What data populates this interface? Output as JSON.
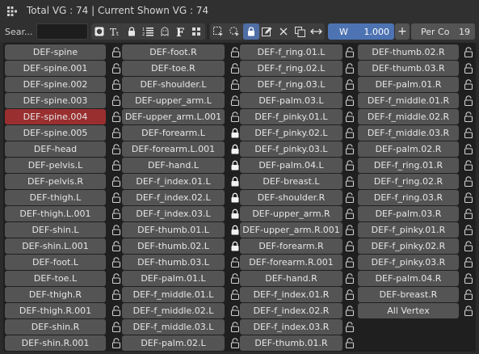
{
  "header": {
    "title": "Total VG : 74 | Current Shown VG : 74",
    "icon": "vertex-groups-icon"
  },
  "toolbar": {
    "search_label": "Sear...",
    "search_value": "",
    "icons": [
      "filter-circle-icon",
      "text-size-icon",
      "lock-icon",
      "numbered-list-icon",
      "ghost-icon",
      "font-f-icon",
      "grid-dots-icon",
      "select-box-icon",
      "select-circle-icon",
      "lock-toggle-icon",
      "edit-icon",
      "close-icon",
      "copy-icon",
      "swap-arrows-icon"
    ],
    "weight_label": "W",
    "weight_value": "1.000",
    "plus_label": "+",
    "perco_label": "Per Co",
    "perco_value": "19"
  },
  "columns": [
    [
      {
        "name": "DEF-spine",
        "locked": false
      },
      {
        "name": "DEF-spine.001",
        "locked": false
      },
      {
        "name": "DEF-spine.002",
        "locked": false
      },
      {
        "name": "DEF-spine.003",
        "locked": false
      },
      {
        "name": "DEF-spine.004",
        "locked": false,
        "selected": true
      },
      {
        "name": "DEF-spine.005",
        "locked": false
      },
      {
        "name": "DEF-head",
        "locked": false
      },
      {
        "name": "DEF-pelvis.L",
        "locked": false
      },
      {
        "name": "DEF-pelvis.R",
        "locked": false
      },
      {
        "name": "DEF-thigh.L",
        "locked": false
      },
      {
        "name": "DEF-thigh.L.001",
        "locked": false
      },
      {
        "name": "DEF-shin.L",
        "locked": false
      },
      {
        "name": "DEF-shin.L.001",
        "locked": false
      },
      {
        "name": "DEF-foot.L",
        "locked": false
      },
      {
        "name": "DEF-toe.L",
        "locked": false
      },
      {
        "name": "DEF-thigh.R",
        "locked": false
      },
      {
        "name": "DEF-thigh.R.001",
        "locked": false
      },
      {
        "name": "DEF-shin.R",
        "locked": false
      },
      {
        "name": "DEF-shin.R.001",
        "locked": false
      }
    ],
    [
      {
        "name": "DEF-foot.R",
        "locked": false
      },
      {
        "name": "DEF-toe.R",
        "locked": false
      },
      {
        "name": "DEF-shoulder.L",
        "locked": false
      },
      {
        "name": "DEF-upper_arm.L",
        "locked": false
      },
      {
        "name": "DEF-upper_arm.L.001",
        "locked": false
      },
      {
        "name": "DEF-forearm.L",
        "locked": true
      },
      {
        "name": "DEF-forearm.L.001",
        "locked": true
      },
      {
        "name": "DEF-hand.L",
        "locked": true
      },
      {
        "name": "DEF-f_index.01.L",
        "locked": true
      },
      {
        "name": "DEF-f_index.02.L",
        "locked": true
      },
      {
        "name": "DEF-f_index.03.L",
        "locked": true
      },
      {
        "name": "DEF-thumb.01.L",
        "locked": true
      },
      {
        "name": "DEF-thumb.02.L",
        "locked": true
      },
      {
        "name": "DEF-thumb.03.L",
        "locked": false
      },
      {
        "name": "DEF-palm.01.L",
        "locked": false
      },
      {
        "name": "DEF-f_middle.01.L",
        "locked": false
      },
      {
        "name": "DEF-f_middle.02.L",
        "locked": false
      },
      {
        "name": "DEF-f_middle.03.L",
        "locked": false
      },
      {
        "name": "DEF-palm.02.L",
        "locked": false
      }
    ],
    [
      {
        "name": "DEF-f_ring.01.L",
        "locked": false
      },
      {
        "name": "DEF-f_ring.02.L",
        "locked": false
      },
      {
        "name": "DEF-f_ring.03.L",
        "locked": false
      },
      {
        "name": "DEF-palm.03.L",
        "locked": false
      },
      {
        "name": "DEF-f_pinky.01.L",
        "locked": false
      },
      {
        "name": "DEF-f_pinky.02.L",
        "locked": false
      },
      {
        "name": "DEF-f_pinky.03.L",
        "locked": false
      },
      {
        "name": "DEF-palm.04.L",
        "locked": false
      },
      {
        "name": "DEF-breast.L",
        "locked": false
      },
      {
        "name": "DEF-shoulder.R",
        "locked": false
      },
      {
        "name": "DEF-upper_arm.R",
        "locked": false
      },
      {
        "name": "DEF-upper_arm.R.001",
        "locked": false
      },
      {
        "name": "DEF-forearm.R",
        "locked": false
      },
      {
        "name": "DEF-forearm.R.001",
        "locked": false
      },
      {
        "name": "DEF-hand.R",
        "locked": false
      },
      {
        "name": "DEF-f_index.01.R",
        "locked": false
      },
      {
        "name": "DEF-f_index.02.R",
        "locked": false
      },
      {
        "name": "DEF-f_index.03.R",
        "locked": false
      },
      {
        "name": "DEF-thumb.01.R",
        "locked": false
      }
    ],
    [
      {
        "name": "DEF-thumb.02.R",
        "locked": false
      },
      {
        "name": "DEF-thumb.03.R",
        "locked": false
      },
      {
        "name": "DEF-palm.01.R",
        "locked": false
      },
      {
        "name": "DEF-f_middle.01.R",
        "locked": false
      },
      {
        "name": "DEF-f_middle.02.R",
        "locked": false
      },
      {
        "name": "DEF-f_middle.03.R",
        "locked": false
      },
      {
        "name": "DEF-palm.02.R",
        "locked": false
      },
      {
        "name": "DEF-f_ring.01.R",
        "locked": false
      },
      {
        "name": "DEF-f_ring.02.R",
        "locked": false
      },
      {
        "name": "DEF-f_ring.03.R",
        "locked": false
      },
      {
        "name": "DEF-palm.03.R",
        "locked": false
      },
      {
        "name": "DEF-f_pinky.01.R",
        "locked": false
      },
      {
        "name": "DEF-f_pinky.02.R",
        "locked": false
      },
      {
        "name": "DEF-f_pinky.03.R",
        "locked": false
      },
      {
        "name": "DEF-palm.04.R",
        "locked": false
      },
      {
        "name": "DEF-breast.R",
        "locked": false
      },
      {
        "name": "All Vertex",
        "locked": false
      }
    ]
  ],
  "colors": {
    "background": "#2b2b2b",
    "button": "#545454",
    "selected": "#9a2f2f",
    "accent": "#4d73b3"
  }
}
